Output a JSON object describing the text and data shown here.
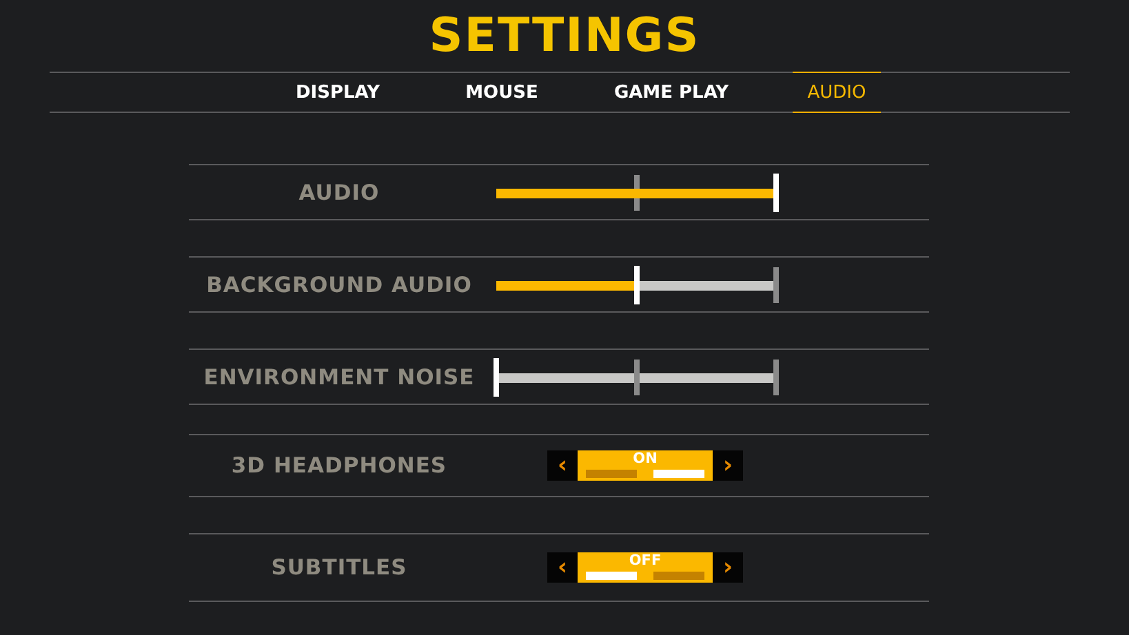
{
  "title": "SETTINGS",
  "tabs": [
    {
      "label": "DISPLAY",
      "selected": false
    },
    {
      "label": "MOUSE",
      "selected": false
    },
    {
      "label": "GAME PLAY",
      "selected": false
    },
    {
      "label": "AUDIO",
      "selected": true
    }
  ],
  "settings": [
    {
      "kind": "slider",
      "label": "AUDIO",
      "level": 1
    },
    {
      "kind": "slider",
      "label": "BACKGROUND AUDIO",
      "level": 0.5
    },
    {
      "kind": "slider",
      "label": "ENVIRONMENT NOISE",
      "level": 0
    },
    {
      "kind": "toggle",
      "label": "3D HEADPHONES",
      "on": true,
      "value": "ON",
      "prev": "‹",
      "next": "›"
    },
    {
      "kind": "toggle",
      "label": "SUBTITLES",
      "on": false,
      "value": "OFF",
      "prev": "‹",
      "next": "›"
    }
  ]
}
